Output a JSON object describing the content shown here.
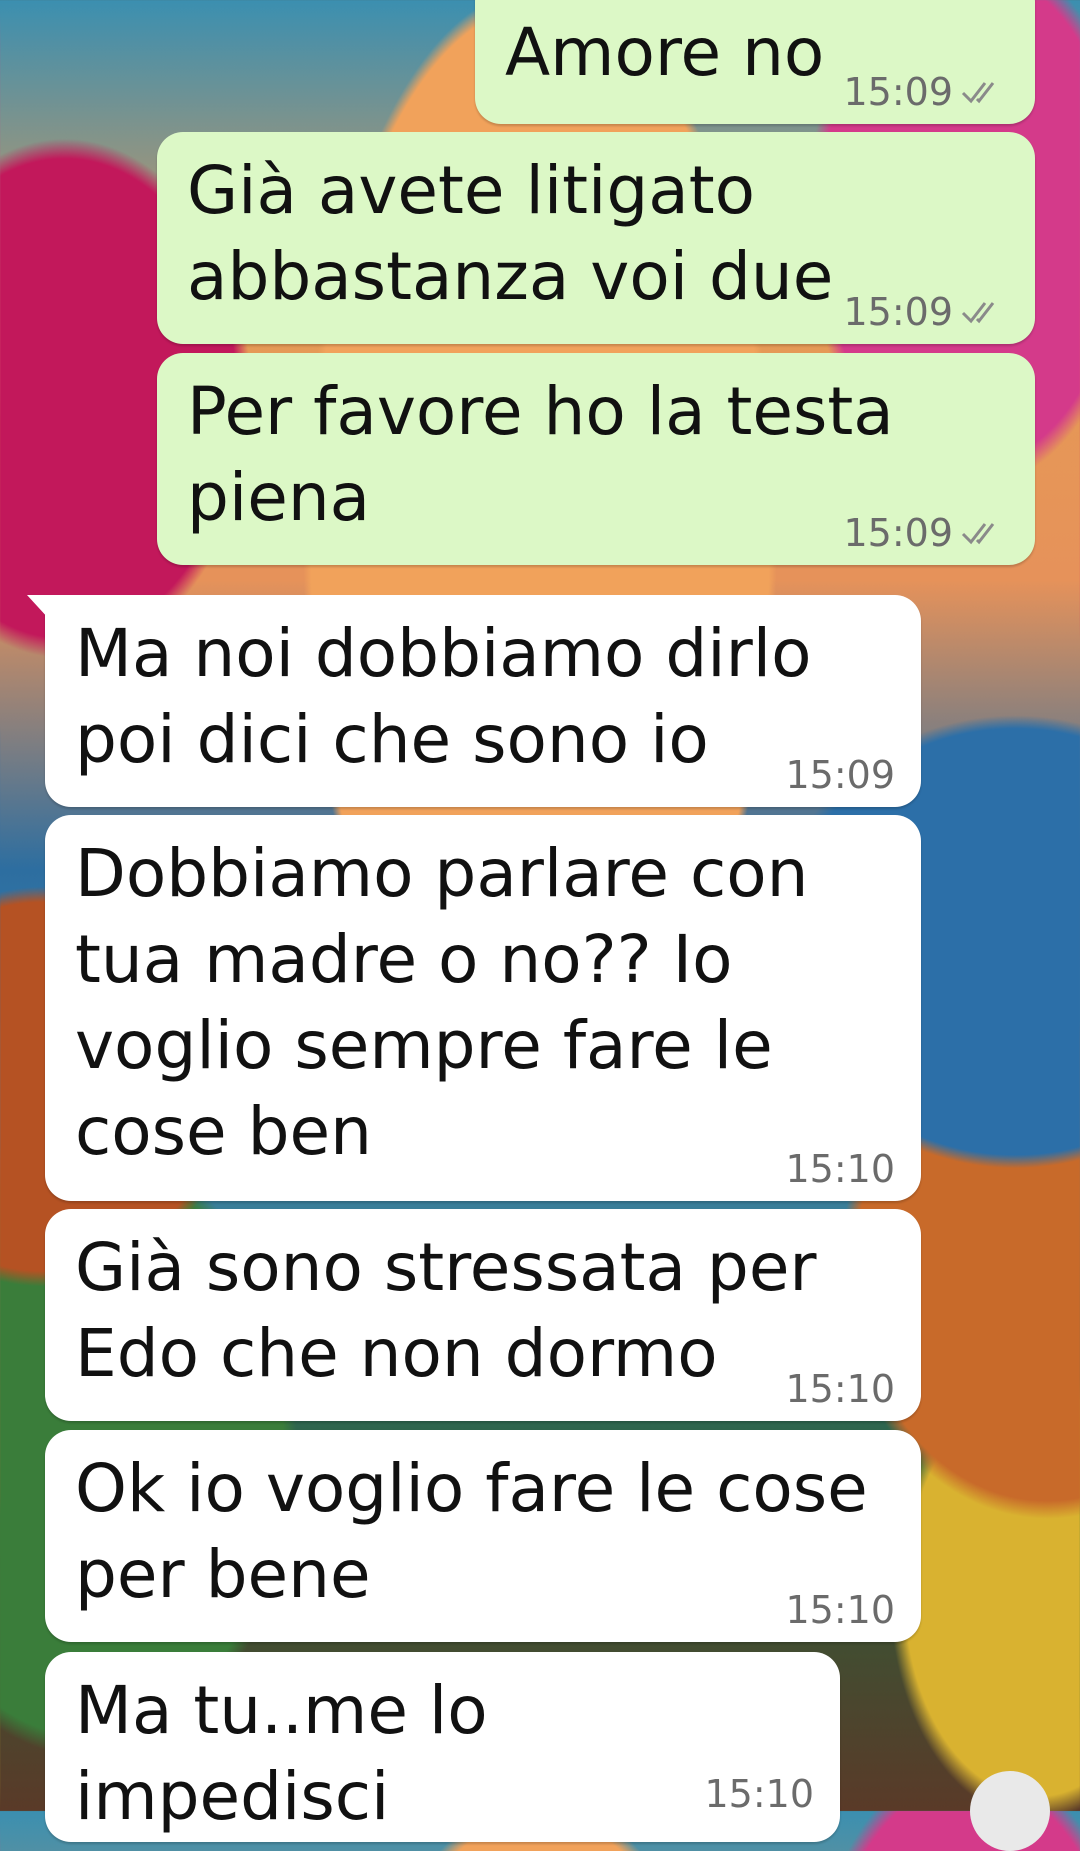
{
  "messages": [
    {
      "direction": "out",
      "text": "Amore no",
      "time": "15:09",
      "status": "read-double-check-icon"
    },
    {
      "direction": "out",
      "text": "Già avete litigato\nabbastanza voi due",
      "time": "15:09",
      "status": "read-double-check-icon"
    },
    {
      "direction": "out",
      "text": "Per favore ho la testa\npiena",
      "time": "15:09",
      "status": "read-double-check-icon"
    },
    {
      "direction": "in",
      "text": "Ma noi dobbiamo dirlo\npoi dici che sono io",
      "time": "15:09"
    },
    {
      "direction": "in",
      "text": "Dobbiamo parlare con\ntua madre o no?? Io\nvoglio sempre fare le\ncose ben",
      "time": "15:10"
    },
    {
      "direction": "in",
      "text": "Già sono stressata per\nEdo che non dormo",
      "time": "15:10"
    },
    {
      "direction": "in",
      "text": "Ok io voglio fare le cose\nper bene",
      "time": "15:10"
    },
    {
      "direction": "in",
      "text": "Ma tu..me lo impedisci",
      "time": "15:10"
    }
  ],
  "colors": {
    "outgoing_bubble": "#dcf8c6",
    "incoming_bubble": "#ffffff",
    "check_marks": "#8a8a8a"
  }
}
